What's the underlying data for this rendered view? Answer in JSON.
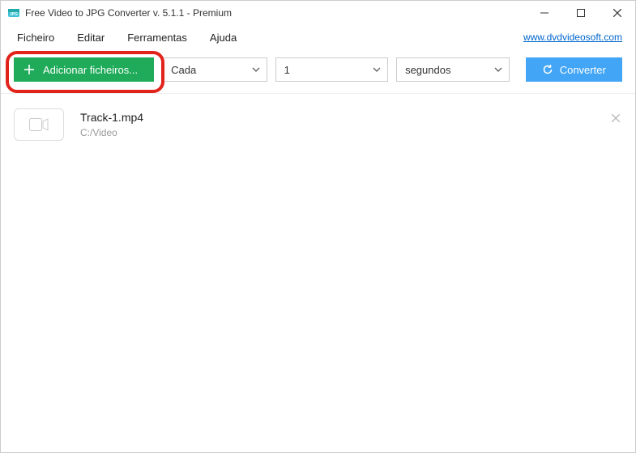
{
  "window": {
    "title": "Free Video to JPG Converter v. 5.1.1 - Premium"
  },
  "menu": {
    "file": "Ficheiro",
    "edit": "Editar",
    "tools": "Ferramentas",
    "help": "Ajuda",
    "link": "www.dvdvideosoft.com"
  },
  "toolbar": {
    "add_label": "Adicionar ficheiros...",
    "mode_value": "Cada",
    "count_value": "1",
    "unit_value": "segundos",
    "convert_label": "Converter"
  },
  "files": [
    {
      "name": "Track-1.mp4",
      "path": "C:/Video"
    }
  ]
}
